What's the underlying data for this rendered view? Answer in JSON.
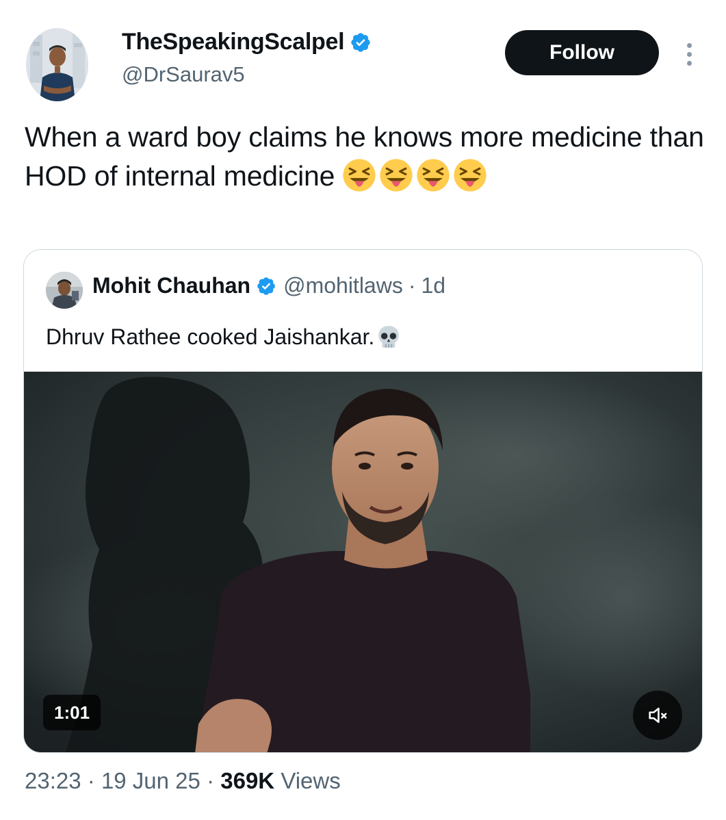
{
  "author": {
    "display_name": "TheSpeakingScalpel",
    "handle": "@DrSaurav5",
    "verified": true
  },
  "actions": {
    "follow_label": "Follow",
    "more_icon": "more-vertical-icon"
  },
  "tweet": {
    "text": "When a ward boy claims he knows more medicine than HOD of internal medicine",
    "emojis": [
      "squinting-tongue-emoji",
      "squinting-tongue-emoji",
      "squinting-tongue-emoji",
      "squinting-tongue-emoji"
    ]
  },
  "quoted": {
    "name": "Mohit Chauhan",
    "handle": "@mohitlaws",
    "separator": "·",
    "time": "1d",
    "text": "Dhruv Rathee cooked Jaishankar.",
    "emoji": "skull-emoji",
    "video": {
      "duration": "1:01",
      "muted": true
    }
  },
  "meta": {
    "time": "23:23",
    "date": "19 Jun 25",
    "separator": "·",
    "views_count": "369K",
    "views_label": "Views"
  },
  "colors": {
    "verified_blue": "#1d9bf0",
    "text_primary": "#0f1419",
    "text_secondary": "#536471",
    "follow_bg": "#0f1419",
    "border": "#cfd9de"
  }
}
